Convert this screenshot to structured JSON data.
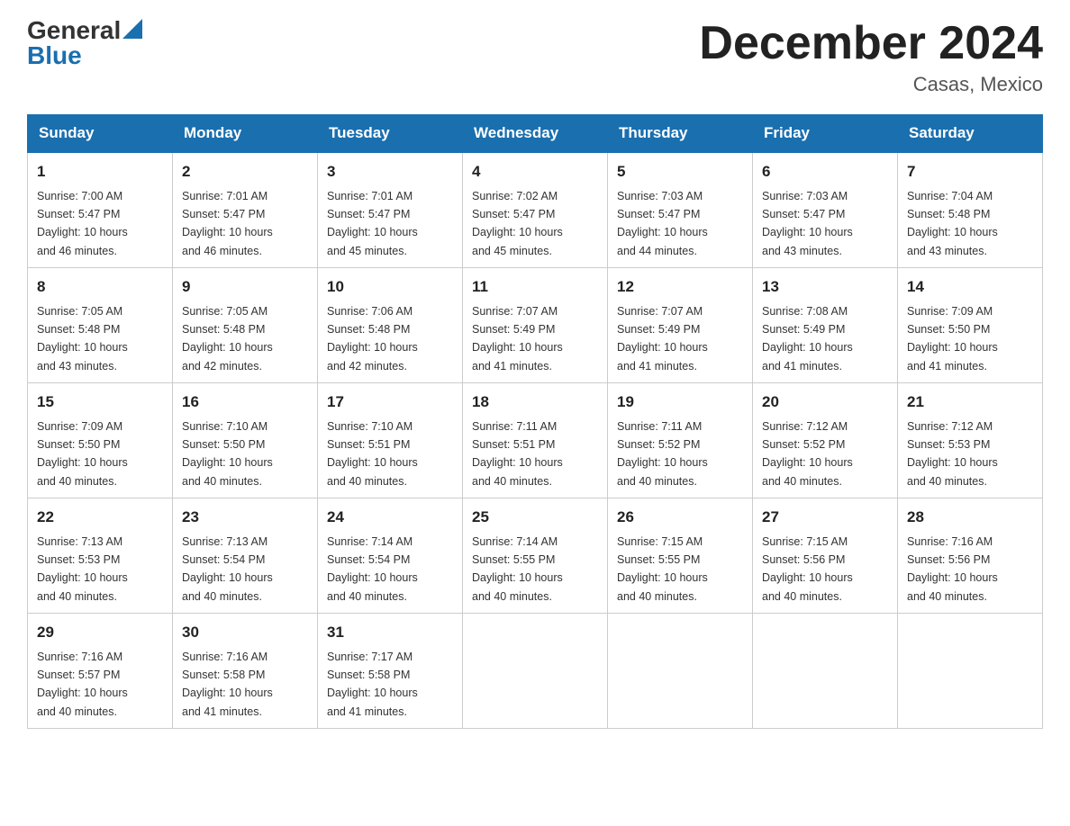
{
  "header": {
    "logo_general": "General",
    "logo_blue": "Blue",
    "month_title": "December 2024",
    "location": "Casas, Mexico"
  },
  "weekdays": [
    "Sunday",
    "Monday",
    "Tuesday",
    "Wednesday",
    "Thursday",
    "Friday",
    "Saturday"
  ],
  "weeks": [
    [
      {
        "day": "1",
        "sunrise": "7:00 AM",
        "sunset": "5:47 PM",
        "daylight": "10 hours and 46 minutes."
      },
      {
        "day": "2",
        "sunrise": "7:01 AM",
        "sunset": "5:47 PM",
        "daylight": "10 hours and 46 minutes."
      },
      {
        "day": "3",
        "sunrise": "7:01 AM",
        "sunset": "5:47 PM",
        "daylight": "10 hours and 45 minutes."
      },
      {
        "day": "4",
        "sunrise": "7:02 AM",
        "sunset": "5:47 PM",
        "daylight": "10 hours and 45 minutes."
      },
      {
        "day": "5",
        "sunrise": "7:03 AM",
        "sunset": "5:47 PM",
        "daylight": "10 hours and 44 minutes."
      },
      {
        "day": "6",
        "sunrise": "7:03 AM",
        "sunset": "5:47 PM",
        "daylight": "10 hours and 43 minutes."
      },
      {
        "day": "7",
        "sunrise": "7:04 AM",
        "sunset": "5:48 PM",
        "daylight": "10 hours and 43 minutes."
      }
    ],
    [
      {
        "day": "8",
        "sunrise": "7:05 AM",
        "sunset": "5:48 PM",
        "daylight": "10 hours and 43 minutes."
      },
      {
        "day": "9",
        "sunrise": "7:05 AM",
        "sunset": "5:48 PM",
        "daylight": "10 hours and 42 minutes."
      },
      {
        "day": "10",
        "sunrise": "7:06 AM",
        "sunset": "5:48 PM",
        "daylight": "10 hours and 42 minutes."
      },
      {
        "day": "11",
        "sunrise": "7:07 AM",
        "sunset": "5:49 PM",
        "daylight": "10 hours and 41 minutes."
      },
      {
        "day": "12",
        "sunrise": "7:07 AM",
        "sunset": "5:49 PM",
        "daylight": "10 hours and 41 minutes."
      },
      {
        "day": "13",
        "sunrise": "7:08 AM",
        "sunset": "5:49 PM",
        "daylight": "10 hours and 41 minutes."
      },
      {
        "day": "14",
        "sunrise": "7:09 AM",
        "sunset": "5:50 PM",
        "daylight": "10 hours and 41 minutes."
      }
    ],
    [
      {
        "day": "15",
        "sunrise": "7:09 AM",
        "sunset": "5:50 PM",
        "daylight": "10 hours and 40 minutes."
      },
      {
        "day": "16",
        "sunrise": "7:10 AM",
        "sunset": "5:50 PM",
        "daylight": "10 hours and 40 minutes."
      },
      {
        "day": "17",
        "sunrise": "7:10 AM",
        "sunset": "5:51 PM",
        "daylight": "10 hours and 40 minutes."
      },
      {
        "day": "18",
        "sunrise": "7:11 AM",
        "sunset": "5:51 PM",
        "daylight": "10 hours and 40 minutes."
      },
      {
        "day": "19",
        "sunrise": "7:11 AM",
        "sunset": "5:52 PM",
        "daylight": "10 hours and 40 minutes."
      },
      {
        "day": "20",
        "sunrise": "7:12 AM",
        "sunset": "5:52 PM",
        "daylight": "10 hours and 40 minutes."
      },
      {
        "day": "21",
        "sunrise": "7:12 AM",
        "sunset": "5:53 PM",
        "daylight": "10 hours and 40 minutes."
      }
    ],
    [
      {
        "day": "22",
        "sunrise": "7:13 AM",
        "sunset": "5:53 PM",
        "daylight": "10 hours and 40 minutes."
      },
      {
        "day": "23",
        "sunrise": "7:13 AM",
        "sunset": "5:54 PM",
        "daylight": "10 hours and 40 minutes."
      },
      {
        "day": "24",
        "sunrise": "7:14 AM",
        "sunset": "5:54 PM",
        "daylight": "10 hours and 40 minutes."
      },
      {
        "day": "25",
        "sunrise": "7:14 AM",
        "sunset": "5:55 PM",
        "daylight": "10 hours and 40 minutes."
      },
      {
        "day": "26",
        "sunrise": "7:15 AM",
        "sunset": "5:55 PM",
        "daylight": "10 hours and 40 minutes."
      },
      {
        "day": "27",
        "sunrise": "7:15 AM",
        "sunset": "5:56 PM",
        "daylight": "10 hours and 40 minutes."
      },
      {
        "day": "28",
        "sunrise": "7:16 AM",
        "sunset": "5:56 PM",
        "daylight": "10 hours and 40 minutes."
      }
    ],
    [
      {
        "day": "29",
        "sunrise": "7:16 AM",
        "sunset": "5:57 PM",
        "daylight": "10 hours and 40 minutes."
      },
      {
        "day": "30",
        "sunrise": "7:16 AM",
        "sunset": "5:58 PM",
        "daylight": "10 hours and 41 minutes."
      },
      {
        "day": "31",
        "sunrise": "7:17 AM",
        "sunset": "5:58 PM",
        "daylight": "10 hours and 41 minutes."
      },
      null,
      null,
      null,
      null
    ]
  ],
  "labels": {
    "sunrise": "Sunrise:",
    "sunset": "Sunset:",
    "daylight": "Daylight:"
  }
}
